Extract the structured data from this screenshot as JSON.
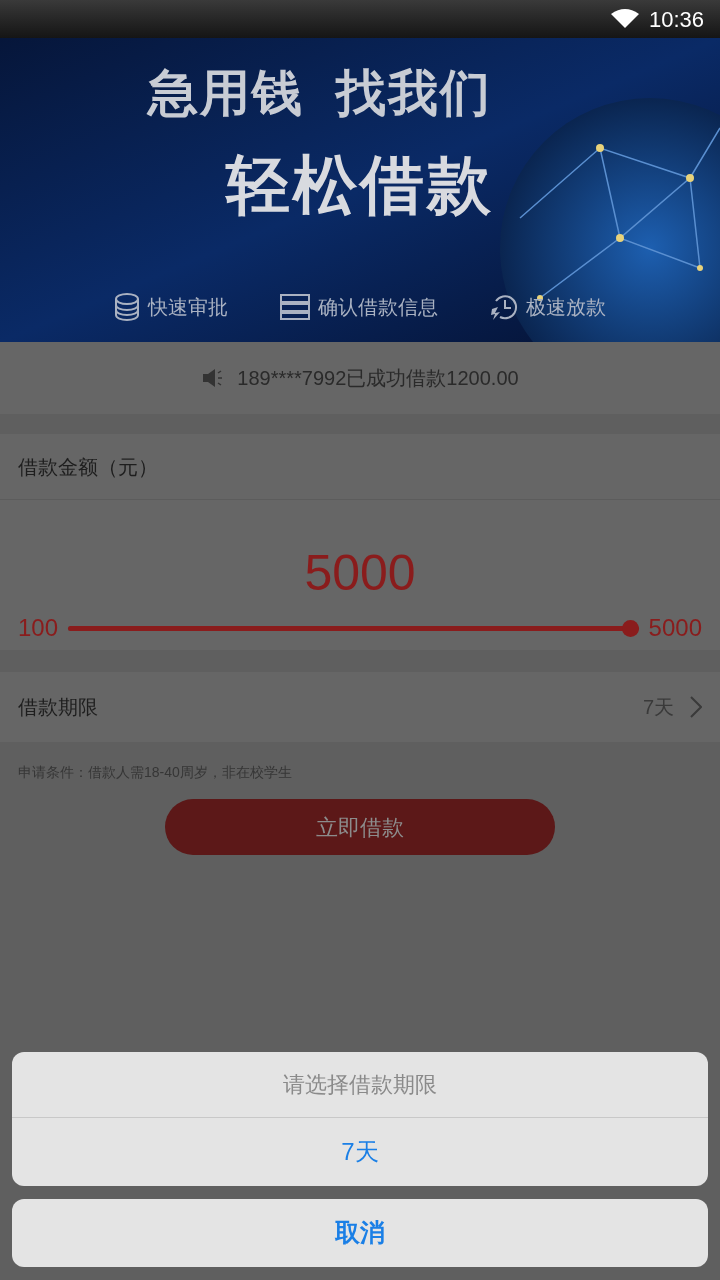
{
  "status_bar": {
    "time": "10:36"
  },
  "banner": {
    "headline": "急用钱  找我们",
    "title": "轻松借款",
    "features": [
      {
        "kind": "coins",
        "label": "快速审批"
      },
      {
        "kind": "server",
        "label": "确认借款信息"
      },
      {
        "kind": "clock",
        "label": "极速放款"
      }
    ]
  },
  "notice": {
    "text": "189****7992已成功借款1200.00"
  },
  "amount": {
    "label": "借款金额（元）",
    "value": "5000",
    "min": "100",
    "max": "5000",
    "level": 1.0
  },
  "term": {
    "label": "借款期限",
    "value": "7天"
  },
  "condition": "申请条件：借款人需18-40周岁，非在校学生",
  "submit": "立即借款",
  "action_sheet": {
    "title": "请选择借款期限",
    "options": [
      "7天"
    ],
    "cancel": "取消"
  }
}
